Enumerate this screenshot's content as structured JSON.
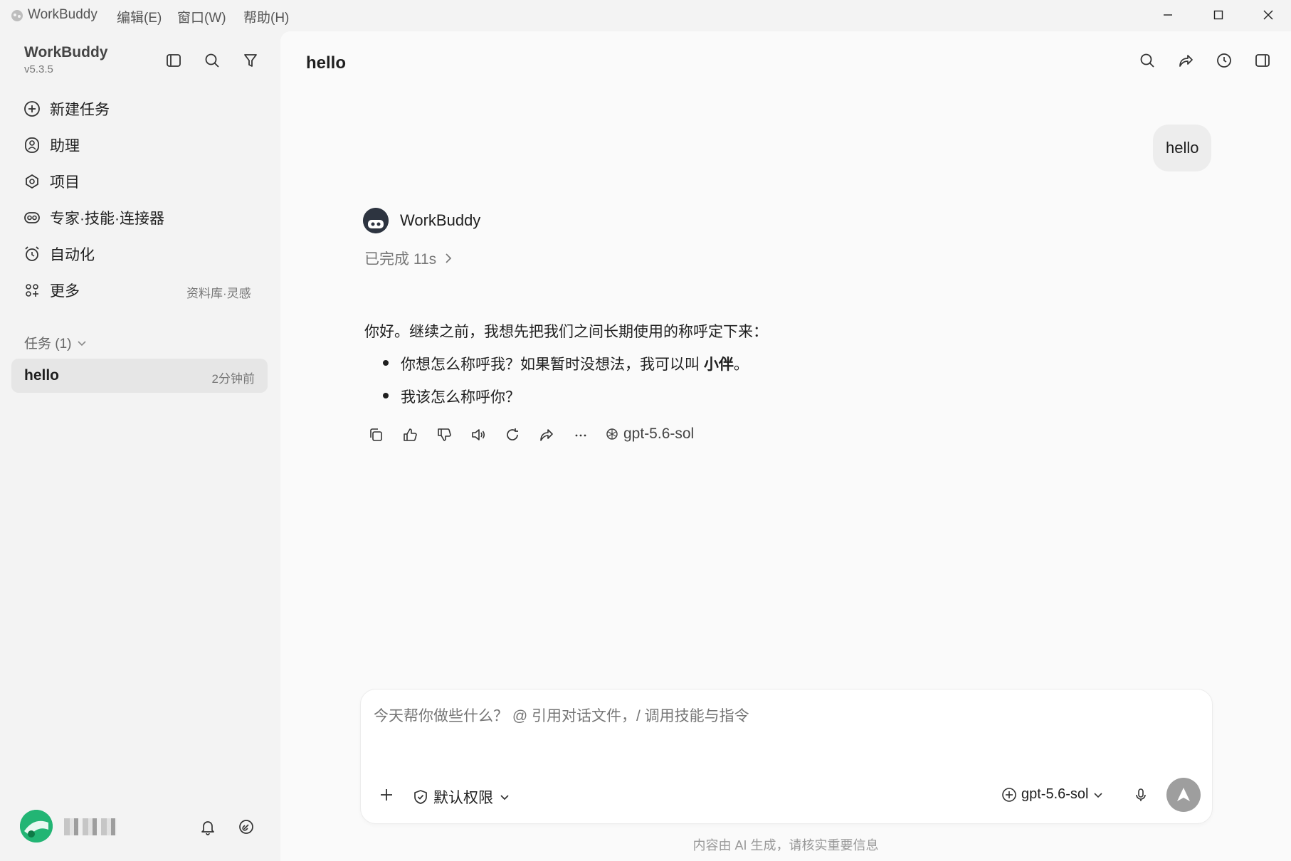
{
  "titlebar": {
    "app_name": "WorkBuddy",
    "menu": [
      "编辑(E)",
      "窗口(W)",
      "帮助(H)"
    ]
  },
  "sidebar": {
    "app_name": "WorkBuddy",
    "version": "v5.3.5",
    "nav": [
      {
        "label": "新建任务",
        "icon": "plus-circle-icon"
      },
      {
        "label": "助理",
        "icon": "assistant-icon"
      },
      {
        "label": "项目",
        "icon": "project-icon"
      },
      {
        "label": "专家·技能·连接器",
        "icon": "expert-icon"
      },
      {
        "label": "自动化",
        "icon": "alarm-clock-icon"
      },
      {
        "label": "更多",
        "icon": "grid-icon",
        "hint": "资料库·灵感"
      }
    ],
    "tasks_header": "任务 (1)",
    "tasks": [
      {
        "title": "hello",
        "time": "2分钟前"
      }
    ]
  },
  "chat": {
    "title": "hello",
    "user_message": "hello",
    "assistant_name": "WorkBuddy",
    "status": "已完成 11s",
    "reply_intro": "你好。继续之前，我想先把我们之间长期使用的称呼定下来：",
    "bullet1_pre": "你想怎么称呼我？如果暂时没想法，我可以叫 ",
    "bullet1_bold": "小伴",
    "bullet1_post": "。",
    "bullet2": "我该怎么称呼你？",
    "model_tag": "gpt-5.6-sol"
  },
  "composer": {
    "placeholder": "今天帮你做些什么？ @ 引用对话文件，/ 调用技能与指令",
    "permission": "默认权限",
    "model": "gpt-5.6-sol"
  },
  "footer": {
    "disclaimer": "内容由 AI 生成，请核实重要信息"
  },
  "colors": {
    "accent_arrow": "#1a9ae0",
    "send_button": "#9e9e9e"
  }
}
